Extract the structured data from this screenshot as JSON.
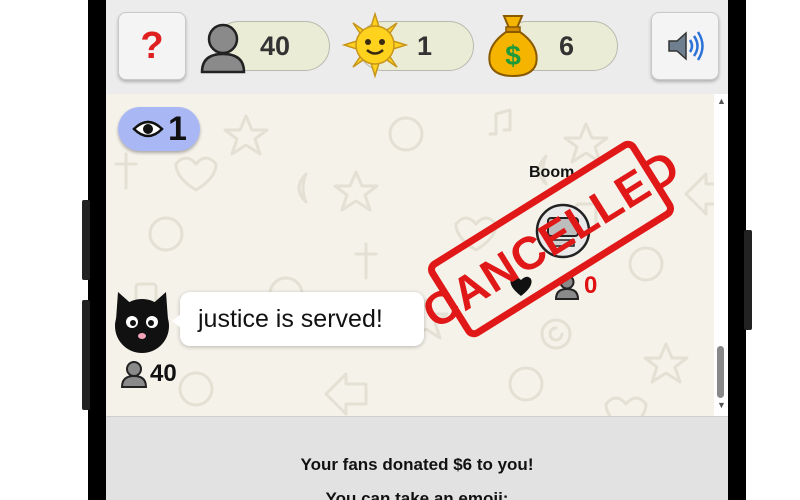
{
  "topbar": {
    "help_label": "?",
    "fans_count": "40",
    "sun_count": "1",
    "money_count": "6"
  },
  "chat": {
    "viewers_count": "1",
    "opponent": {
      "name": "Boom",
      "count": "0",
      "stamp_text": "CANCELLED"
    },
    "player": {
      "message": "justice is served!",
      "count": "40"
    }
  },
  "bottom": {
    "donation_message": "Your fans donated $6 to you!",
    "emoji_prompt": "You can take an emoji:"
  },
  "colors": {
    "stamp_red": "#e01818",
    "viewers_badge": "#a9b8f5",
    "stat_pill": "#ebecd6",
    "help_red": "#e02020"
  },
  "icons": [
    "question-mark-icon",
    "person-icon",
    "sun-icon",
    "money-bag-icon",
    "speaker-icon",
    "eye-icon",
    "cat-avatar-icon",
    "robot-avatar-icon"
  ]
}
